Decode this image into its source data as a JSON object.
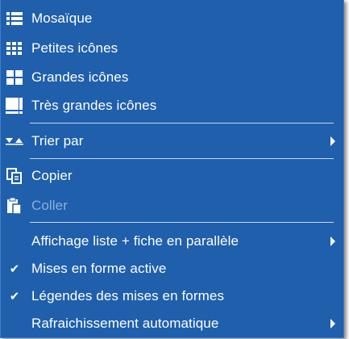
{
  "menu": {
    "items": [
      {
        "label": "Mosaïque",
        "icon": "tiles-icon"
      },
      {
        "label": "Petites icônes",
        "icon": "small-icons-icon"
      },
      {
        "label": "Grandes icônes",
        "icon": "large-icons-icon"
      },
      {
        "label": "Très grandes icônes",
        "icon": "extra-large-icons-icon"
      },
      {
        "label": "Trier par",
        "icon": "sort-icon",
        "submenu": true
      },
      {
        "label": "Copier",
        "icon": "copy-icon"
      },
      {
        "label": "Coller",
        "icon": "paste-icon",
        "disabled": true
      },
      {
        "label": "Affichage liste + fiche en parallèle",
        "submenu": true
      },
      {
        "label": "Mises en forme active",
        "checked": true
      },
      {
        "label": "Légendes des mises en formes",
        "checked": true
      },
      {
        "label": "Rafraichissement automatique",
        "submenu": true
      }
    ],
    "check_glyph": "✔"
  },
  "colors": {
    "background": "#1f5fac",
    "text": "#ffffff",
    "disabled_text": "#8fb0d8",
    "separator": "#c8d8ee"
  }
}
